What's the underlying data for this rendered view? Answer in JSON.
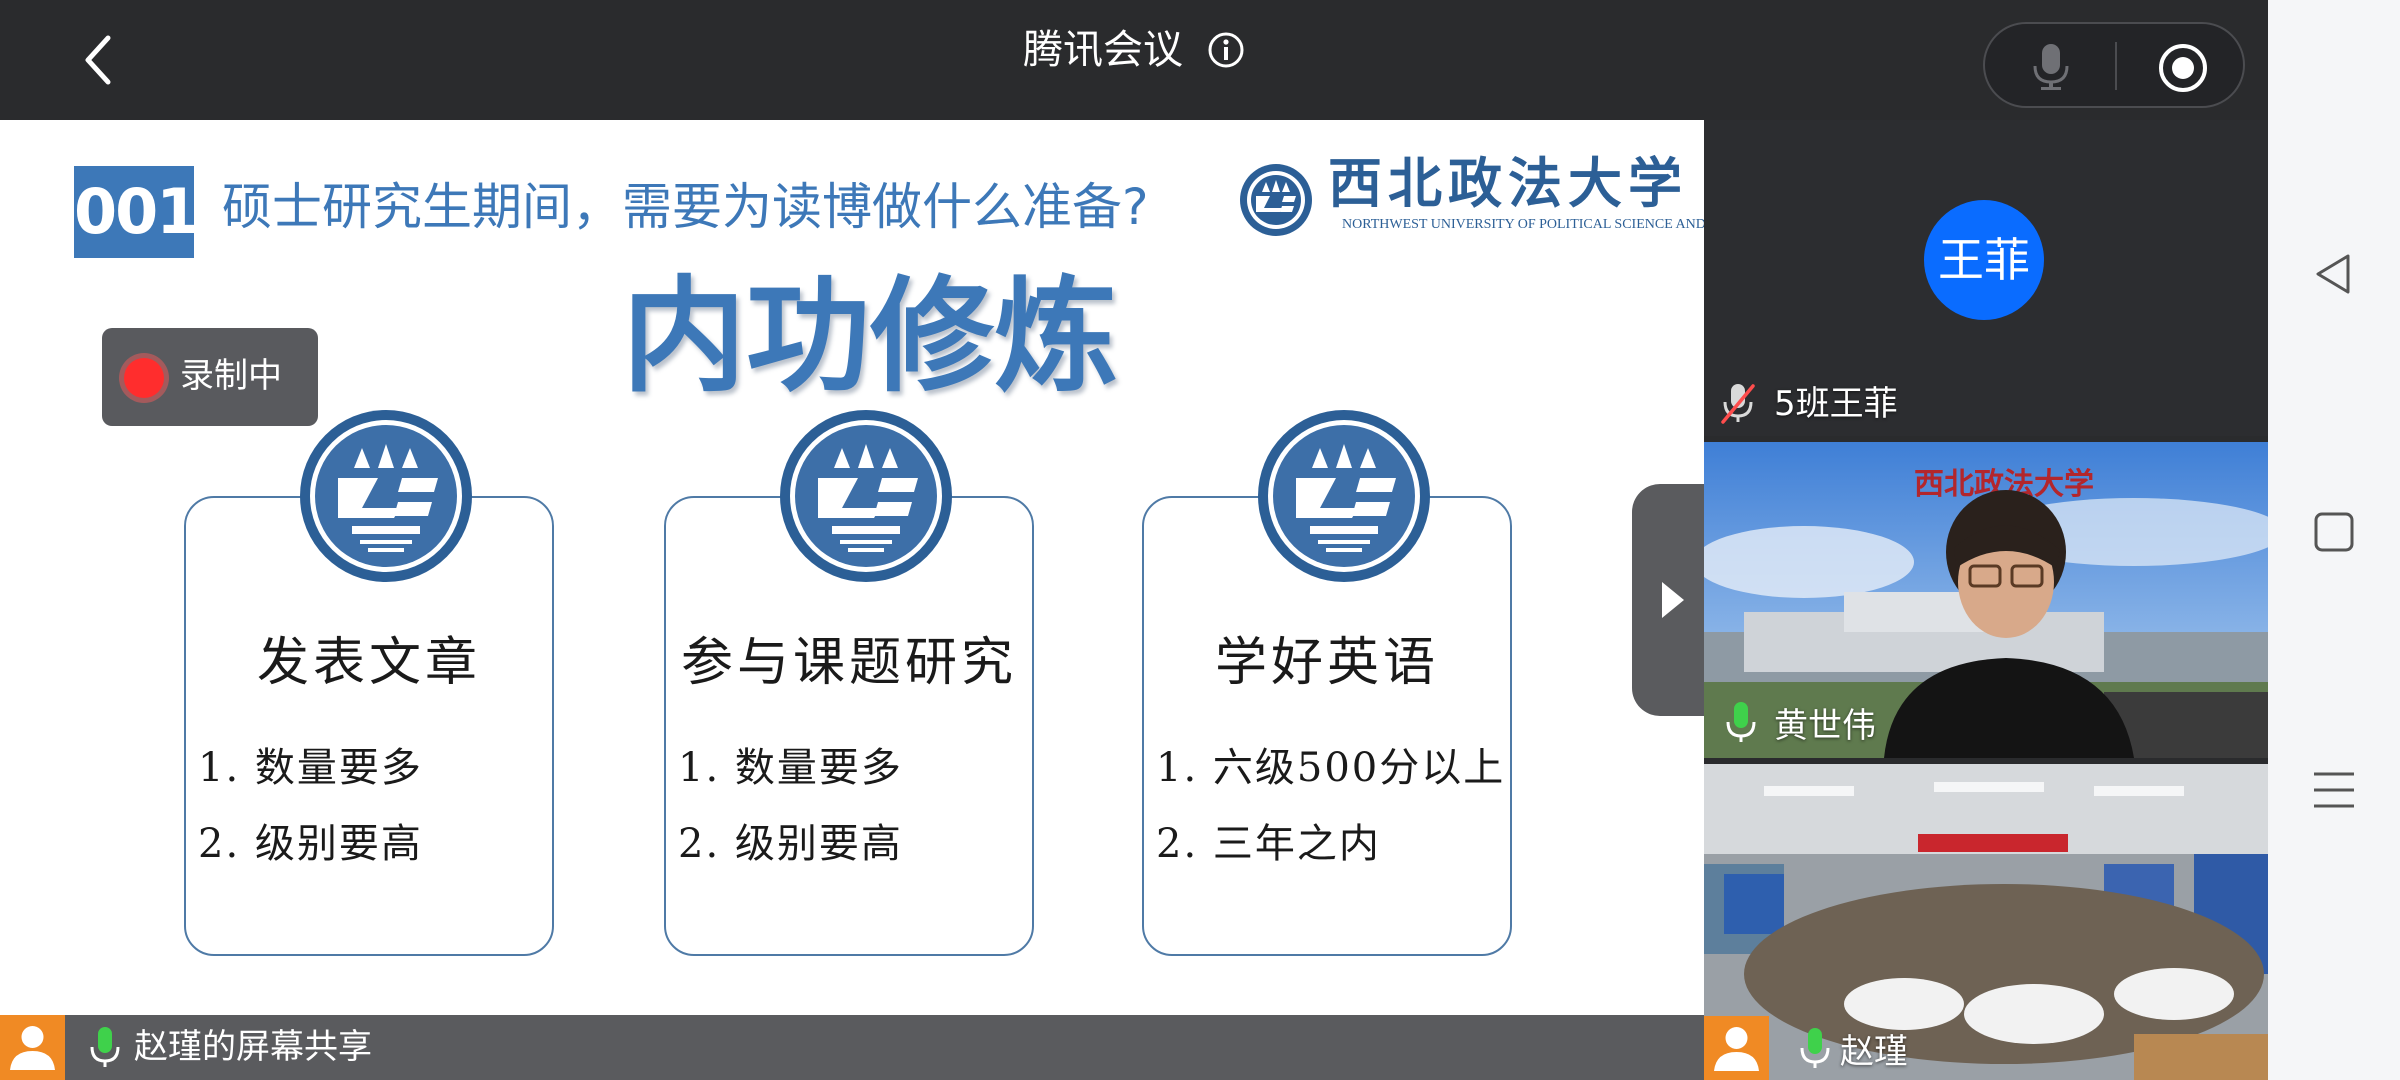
{
  "header": {
    "title": "腾讯会议"
  },
  "slide": {
    "number": "001",
    "question": "硕士研究生期间，需要为读博做什么准备?",
    "university_cn": "西北政法大学",
    "university_en": "NORTHWEST UNIVERSITY OF POLITICAL SCIENCE AND LAW",
    "main_title": "内功修炼",
    "cards": [
      {
        "title": "发表文章",
        "items": [
          "1. 数量要多",
          "2. 级别要高"
        ]
      },
      {
        "title": "参与课题研究",
        "items": [
          "1. 数量要多",
          "2. 级别要高"
        ]
      },
      {
        "title": "学好英语",
        "items": [
          "1. 六级500分以上",
          "2. 三年之内"
        ]
      }
    ]
  },
  "recording": {
    "label": "录制中"
  },
  "share_bar": {
    "label": "赵瑾的屏幕共享"
  },
  "participants": [
    {
      "avatar_text": "王菲",
      "name": "5班王菲",
      "mic": "muted"
    },
    {
      "name": "黄世伟",
      "mic": "active"
    },
    {
      "name": "赵瑾",
      "mic": "active"
    }
  ],
  "colors": {
    "accent_blue": "#3d78b8",
    "avatar_blue": "#0a6cff",
    "mic_green": "#3fd14b",
    "record_red": "#ff2d2d",
    "orange": "#f08a24"
  },
  "icons": {
    "back": "chevron-left-icon",
    "info": "info-icon",
    "mic": "microphone-icon",
    "record": "record-icon",
    "next": "play-triangle-icon",
    "nav_back": "triangle-back-icon",
    "nav_home": "square-home-icon",
    "nav_menu": "menu-lines-icon"
  }
}
